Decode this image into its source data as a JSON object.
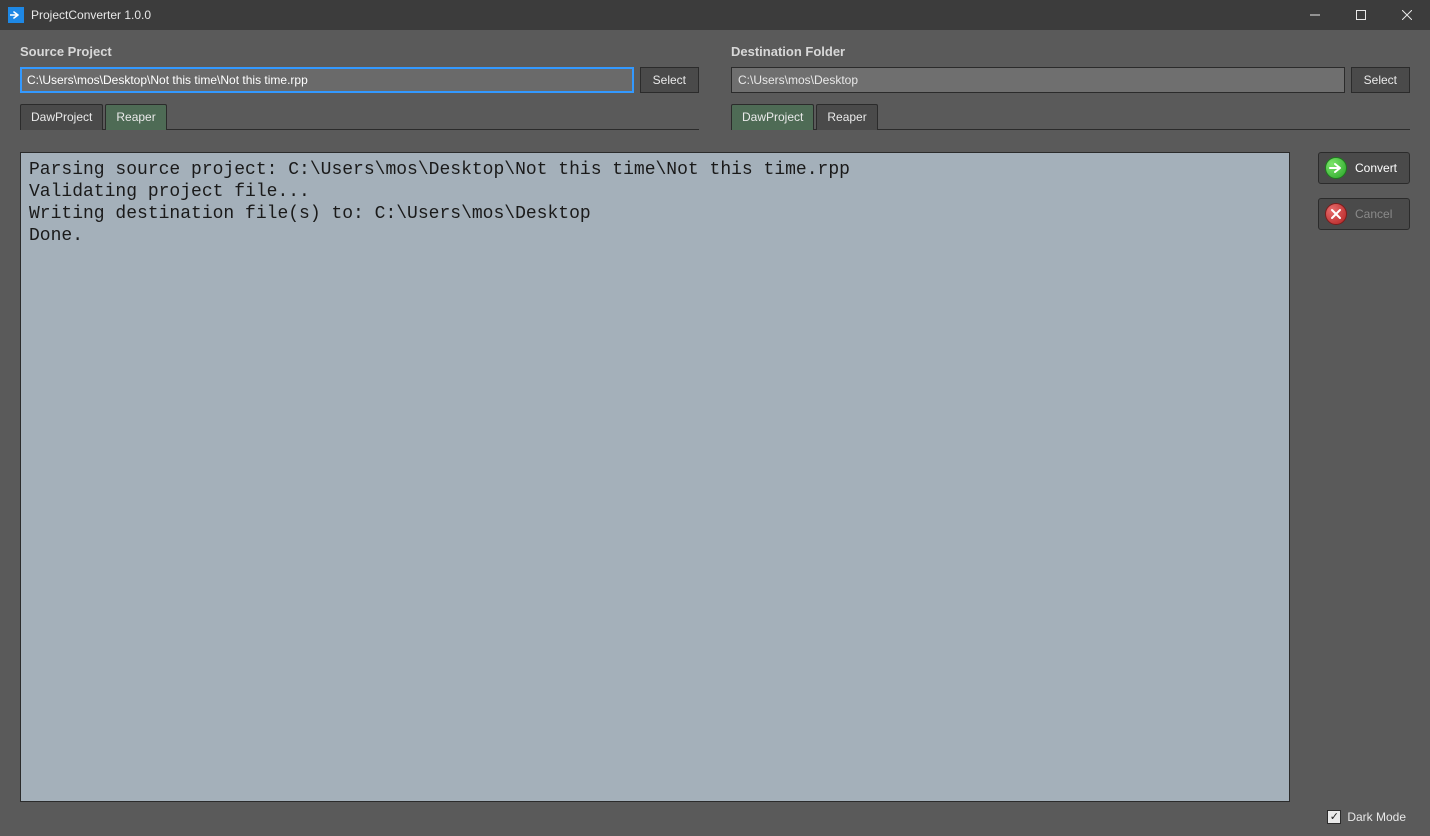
{
  "window": {
    "title": "ProjectConverter 1.0.0"
  },
  "source": {
    "label": "Source Project",
    "path": "C:\\Users\\mos\\Desktop\\Not this time\\Not this time.rpp",
    "select_label": "Select",
    "tabs": [
      {
        "label": "DawProject",
        "active": false
      },
      {
        "label": "Reaper",
        "active": true
      }
    ]
  },
  "destination": {
    "label": "Destination Folder",
    "path": "C:\\Users\\mos\\Desktop",
    "select_label": "Select",
    "tabs": [
      {
        "label": "DawProject",
        "active": true
      },
      {
        "label": "Reaper",
        "active": false
      }
    ]
  },
  "log": "Parsing source project: C:\\Users\\mos\\Desktop\\Not this time\\Not this time.rpp\nValidating project file...\nWriting destination file(s) to: C:\\Users\\mos\\Desktop\nDone.",
  "actions": {
    "convert_label": "Convert",
    "cancel_label": "Cancel",
    "cancel_disabled": true
  },
  "footer": {
    "dark_mode_label": "Dark Mode",
    "dark_mode_checked": true
  }
}
